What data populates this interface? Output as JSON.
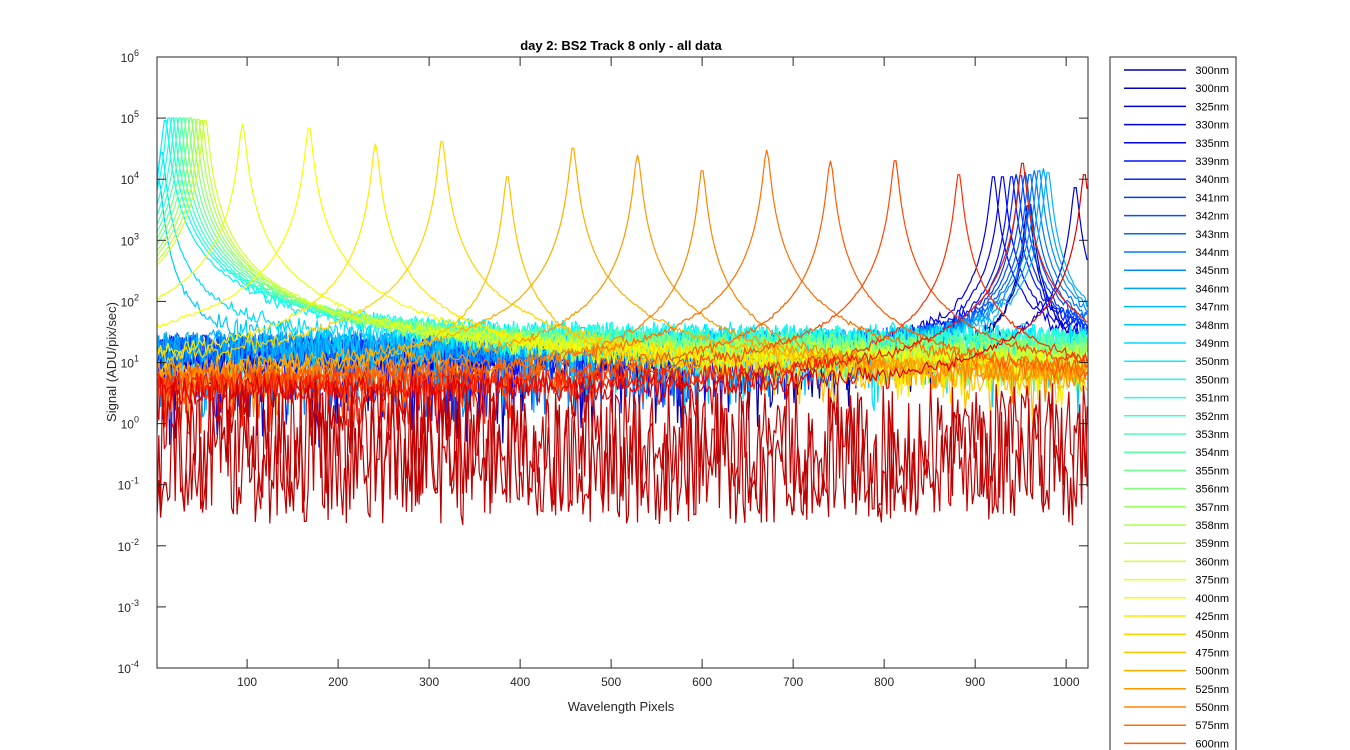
{
  "chart_data": {
    "type": "line",
    "title": "day 2: BS2   Track 8 only - all data",
    "xlabel": "Wavelength Pixels",
    "ylabel": "Signal (ADU/pix/sec)",
    "xlim": [
      1,
      1024
    ],
    "ylim": [
      0.0001,
      1000000
    ],
    "yscale": "log",
    "x_ticks": [
      100,
      200,
      300,
      400,
      500,
      600,
      700,
      800,
      900,
      1000
    ],
    "y_ticks": [
      {
        "base": "10",
        "exp": "-4",
        "value": 0.0001
      },
      {
        "base": "10",
        "exp": "-3",
        "value": 0.001
      },
      {
        "base": "10",
        "exp": "-2",
        "value": 0.01
      },
      {
        "base": "10",
        "exp": "-1",
        "value": 0.1
      },
      {
        "base": "10",
        "exp": "0",
        "value": 1
      },
      {
        "base": "10",
        "exp": "1",
        "value": 10
      },
      {
        "base": "10",
        "exp": "2",
        "value": 100
      },
      {
        "base": "10",
        "exp": "3",
        "value": 1000
      },
      {
        "base": "10",
        "exp": "4",
        "value": 10000
      },
      {
        "base": "10",
        "exp": "5",
        "value": 100000
      },
      {
        "base": "10",
        "exp": "6",
        "value": 1000000
      }
    ],
    "grid": false,
    "legend_position": "outside-right",
    "series": [
      {
        "name": "300nm",
        "color": "#0000a8",
        "peak_pixel": 958,
        "peak_value": 4000,
        "baseline": 12
      },
      {
        "name": "300nm",
        "color": "#0000b8",
        "peak_pixel": 960,
        "peak_value": 4200,
        "baseline": 12
      },
      {
        "name": "325nm",
        "color": "#0000d0",
        "peak_pixel": 1010,
        "peak_value": 8000,
        "baseline": 10
      },
      {
        "name": "330nm",
        "color": "#0000e6",
        "peak_pixel": 920,
        "peak_value": 12000,
        "baseline": 15
      },
      {
        "name": "335nm",
        "color": "#0000ff",
        "peak_pixel": 930,
        "peak_value": 12000,
        "baseline": 15
      },
      {
        "name": "339nm",
        "color": "#0014ff",
        "peak_pixel": 940,
        "peak_value": 12000,
        "baseline": 15
      },
      {
        "name": "340nm",
        "color": "#0028ff",
        "peak_pixel": 945,
        "peak_value": 12000,
        "baseline": 15
      },
      {
        "name": "341nm",
        "color": "#003cff",
        "peak_pixel": 950,
        "peak_value": 12500,
        "baseline": 15
      },
      {
        "name": "342nm",
        "color": "#0050ff",
        "peak_pixel": 955,
        "peak_value": 13000,
        "baseline": 16
      },
      {
        "name": "343nm",
        "color": "#0064ff",
        "peak_pixel": 960,
        "peak_value": 13000,
        "baseline": 16
      },
      {
        "name": "344nm",
        "color": "#0078ff",
        "peak_pixel": 965,
        "peak_value": 14000,
        "baseline": 16
      },
      {
        "name": "345nm",
        "color": "#008cff",
        "peak_pixel": 970,
        "peak_value": 15000,
        "baseline": 17
      },
      {
        "name": "346nm",
        "color": "#00a0ff",
        "peak_pixel": 975,
        "peak_value": 15000,
        "baseline": 17
      },
      {
        "name": "347nm",
        "color": "#00b4ff",
        "peak_pixel": 980,
        "peak_value": 14000,
        "baseline": 18
      },
      {
        "name": "348nm",
        "color": "#00c8ff",
        "peak_pixel": 3,
        "peak_value": 10000,
        "baseline": 20
      },
      {
        "name": "349nm",
        "color": "#00dcff",
        "peak_pixel": 6,
        "peak_value": 30000,
        "baseline": 22
      },
      {
        "name": "350nm",
        "color": "#00f0ff",
        "peak_pixel": 10,
        "peak_value": 100000,
        "baseline": 22
      },
      {
        "name": "350nm",
        "color": "#0cfff2",
        "peak_pixel": 14,
        "peak_value": 110000,
        "baseline": 20
      },
      {
        "name": "351nm",
        "color": "#20ffdf",
        "peak_pixel": 18,
        "peak_value": 110000,
        "baseline": 18
      },
      {
        "name": "352nm",
        "color": "#34ffcb",
        "peak_pixel": 22,
        "peak_value": 110000,
        "baseline": 18
      },
      {
        "name": "353nm",
        "color": "#48ffb7",
        "peak_pixel": 26,
        "peak_value": 110000,
        "baseline": 16
      },
      {
        "name": "354nm",
        "color": "#5cffa3",
        "peak_pixel": 30,
        "peak_value": 110000,
        "baseline": 15
      },
      {
        "name": "355nm",
        "color": "#70ff8f",
        "peak_pixel": 34,
        "peak_value": 110000,
        "baseline": 14
      },
      {
        "name": "356nm",
        "color": "#84ff7b",
        "peak_pixel": 38,
        "peak_value": 110000,
        "baseline": 13
      },
      {
        "name": "357nm",
        "color": "#98ff67",
        "peak_pixel": 42,
        "peak_value": 105000,
        "baseline": 12
      },
      {
        "name": "358nm",
        "color": "#acff53",
        "peak_pixel": 46,
        "peak_value": 105000,
        "baseline": 11
      },
      {
        "name": "359nm",
        "color": "#c0ff3f",
        "peak_pixel": 50,
        "peak_value": 100000,
        "baseline": 10
      },
      {
        "name": "360nm",
        "color": "#d4ff2b",
        "peak_pixel": 54,
        "peak_value": 100000,
        "baseline": 9
      },
      {
        "name": "375nm",
        "color": "#e8ff17",
        "peak_pixel": 95,
        "peak_value": 80000,
        "baseline": 8
      },
      {
        "name": "400nm",
        "color": "#fcfc00",
        "peak_pixel": 168,
        "peak_value": 75000,
        "baseline": 7
      },
      {
        "name": "425nm",
        "color": "#ffe800",
        "peak_pixel": 241,
        "peak_value": 38000,
        "baseline": 6
      },
      {
        "name": "450nm",
        "color": "#ffd400",
        "peak_pixel": 314,
        "peak_value": 45000,
        "baseline": 6
      },
      {
        "name": "475nm",
        "color": "#ffc000",
        "peak_pixel": 386,
        "peak_value": 12000,
        "baseline": 5
      },
      {
        "name": "500nm",
        "color": "#ffac00",
        "peak_pixel": 458,
        "peak_value": 35000,
        "baseline": 5
      },
      {
        "name": "525nm",
        "color": "#ff9800",
        "peak_pixel": 529,
        "peak_value": 25000,
        "baseline": 5
      },
      {
        "name": "550nm",
        "color": "#ff8400",
        "peak_pixel": 600,
        "peak_value": 15000,
        "baseline": 4.5
      },
      {
        "name": "575nm",
        "color": "#ff7000",
        "peak_pixel": 671,
        "peak_value": 30000,
        "baseline": 4.5
      },
      {
        "name": "600nm",
        "color": "#ff5c00",
        "peak_pixel": 741,
        "peak_value": 20000,
        "baseline": 4
      },
      {
        "color": "#ff4800",
        "peak_pixel": 812,
        "peak_value": 22000,
        "baseline": 4
      },
      {
        "color": "#ff3000",
        "peak_pixel": 882,
        "peak_value": 13000,
        "baseline": 3.5
      },
      {
        "color": "#f01800",
        "peak_pixel": 952,
        "peak_value": 20000,
        "baseline": 3.5
      },
      {
        "color": "#e00000",
        "peak_pixel": 1020,
        "peak_value": 13000,
        "baseline": 3
      },
      {
        "color": "#b40000",
        "peak_pixel": 0,
        "peak_value": 0,
        "baseline": 0.35
      },
      {
        "color": "#c80000",
        "peak_pixel": 0,
        "peak_value": 0,
        "baseline": 0.5
      }
    ]
  }
}
